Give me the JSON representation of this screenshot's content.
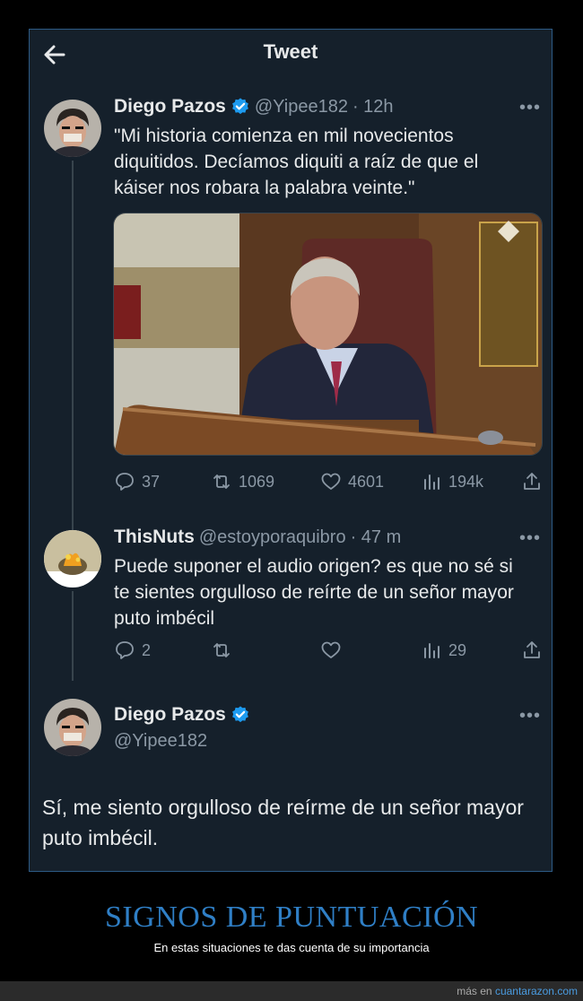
{
  "header": {
    "title": "Tweet",
    "back_icon": "arrow-left-icon"
  },
  "tweets": [
    {
      "name": "Diego Pazos",
      "handle": "@Yipee182",
      "time": "· 12h",
      "text": "\"Mi historia comienza en mil novecientos diquitidos. Decíamos diquiti a raíz de que el káiser nos robara la palabra veinte.\"",
      "stats": {
        "replies": "37",
        "retweets": "1069",
        "likes": "4601",
        "views": "194k"
      }
    },
    {
      "name": "ThisNuts",
      "handle": "@estoyporaquibro",
      "time": "· 47 m",
      "text": "Puede suponer el audio origen? es que no sé si te sientes orgulloso de reírte de un señor mayor puto imbécil",
      "stats": {
        "replies": "2",
        "retweets": "",
        "likes": "",
        "views": "29"
      }
    },
    {
      "name": "Diego Pazos",
      "handle": "@Yipee182",
      "text": "Sí, me siento orgulloso de reírme de un señor mayor puto imbécil."
    }
  ],
  "more_label": "•••",
  "caption": {
    "headline": "SIGNOS DE PUNTUACIÓN",
    "subline": "En estas situaciones te das cuenta de su importancia"
  },
  "footer": {
    "prefix": "más en ",
    "site": "cuantarazon.com"
  },
  "colors": {
    "background": "#15202b",
    "accent": "#1d9bf0",
    "muted": "#8b98a5",
    "headline": "#2f7fc6"
  }
}
